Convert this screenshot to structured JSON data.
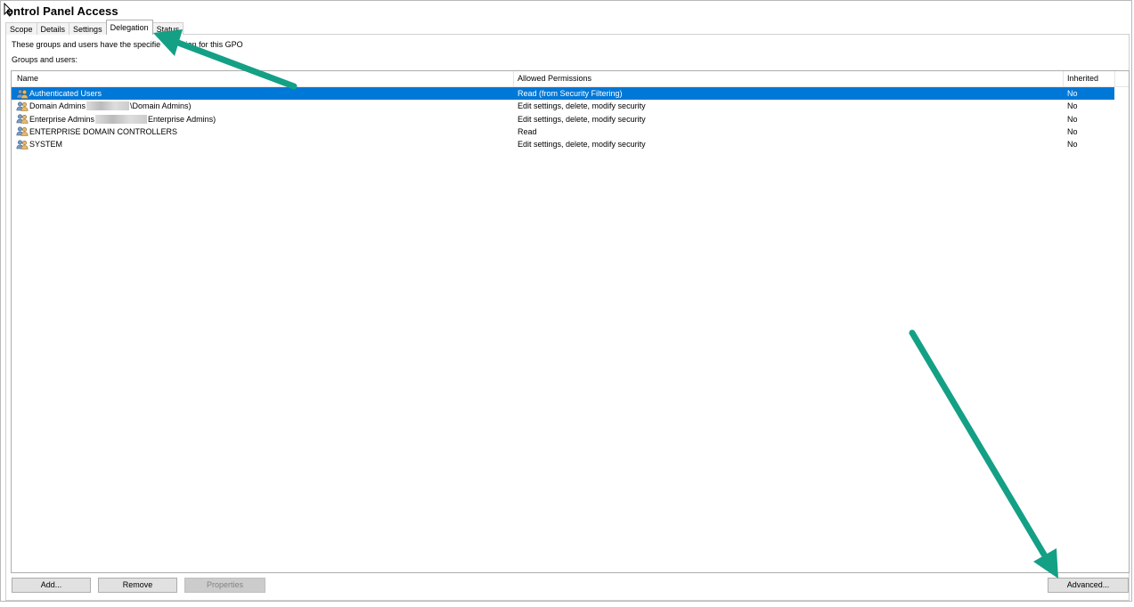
{
  "window": {
    "title": "ontrol Panel Access"
  },
  "tabs": [
    {
      "label": "Scope"
    },
    {
      "label": "Details"
    },
    {
      "label": "Settings"
    },
    {
      "label": "Delegation"
    },
    {
      "label": "Status"
    }
  ],
  "active_tab": "Delegation",
  "description": "These groups and users have the specifie",
  "description_tail": "sion for this GPO",
  "groups_label": "Groups and users:",
  "columns": {
    "name": "Name",
    "permissions": "Allowed Permissions",
    "inherited": "Inherited"
  },
  "rows": [
    {
      "name": "Authenticated Users",
      "name_tail": "",
      "permissions": "Read (from Security Filtering)",
      "inherited": "No",
      "selected": true
    },
    {
      "name": "Domain Admins",
      "name_tail": "\\Domain Admins)",
      "permissions": "Edit settings, delete, modify security",
      "inherited": "No",
      "selected": false
    },
    {
      "name": "Enterprise Admins",
      "name_tail": "Enterprise Admins)",
      "permissions": "Edit settings, delete, modify security",
      "inherited": "No",
      "selected": false
    },
    {
      "name": "ENTERPRISE DOMAIN CONTROLLERS",
      "name_tail": "",
      "permissions": "Read",
      "inherited": "No",
      "selected": false
    },
    {
      "name": "SYSTEM",
      "name_tail": "",
      "permissions": "Edit settings, delete, modify security",
      "inherited": "No",
      "selected": false
    }
  ],
  "buttons": {
    "add": "Add...",
    "remove": "Remove",
    "properties": "Properties",
    "advanced": "Advanced..."
  },
  "colors": {
    "selection": "#0078d7",
    "annotation_arrow": "#14a085"
  }
}
